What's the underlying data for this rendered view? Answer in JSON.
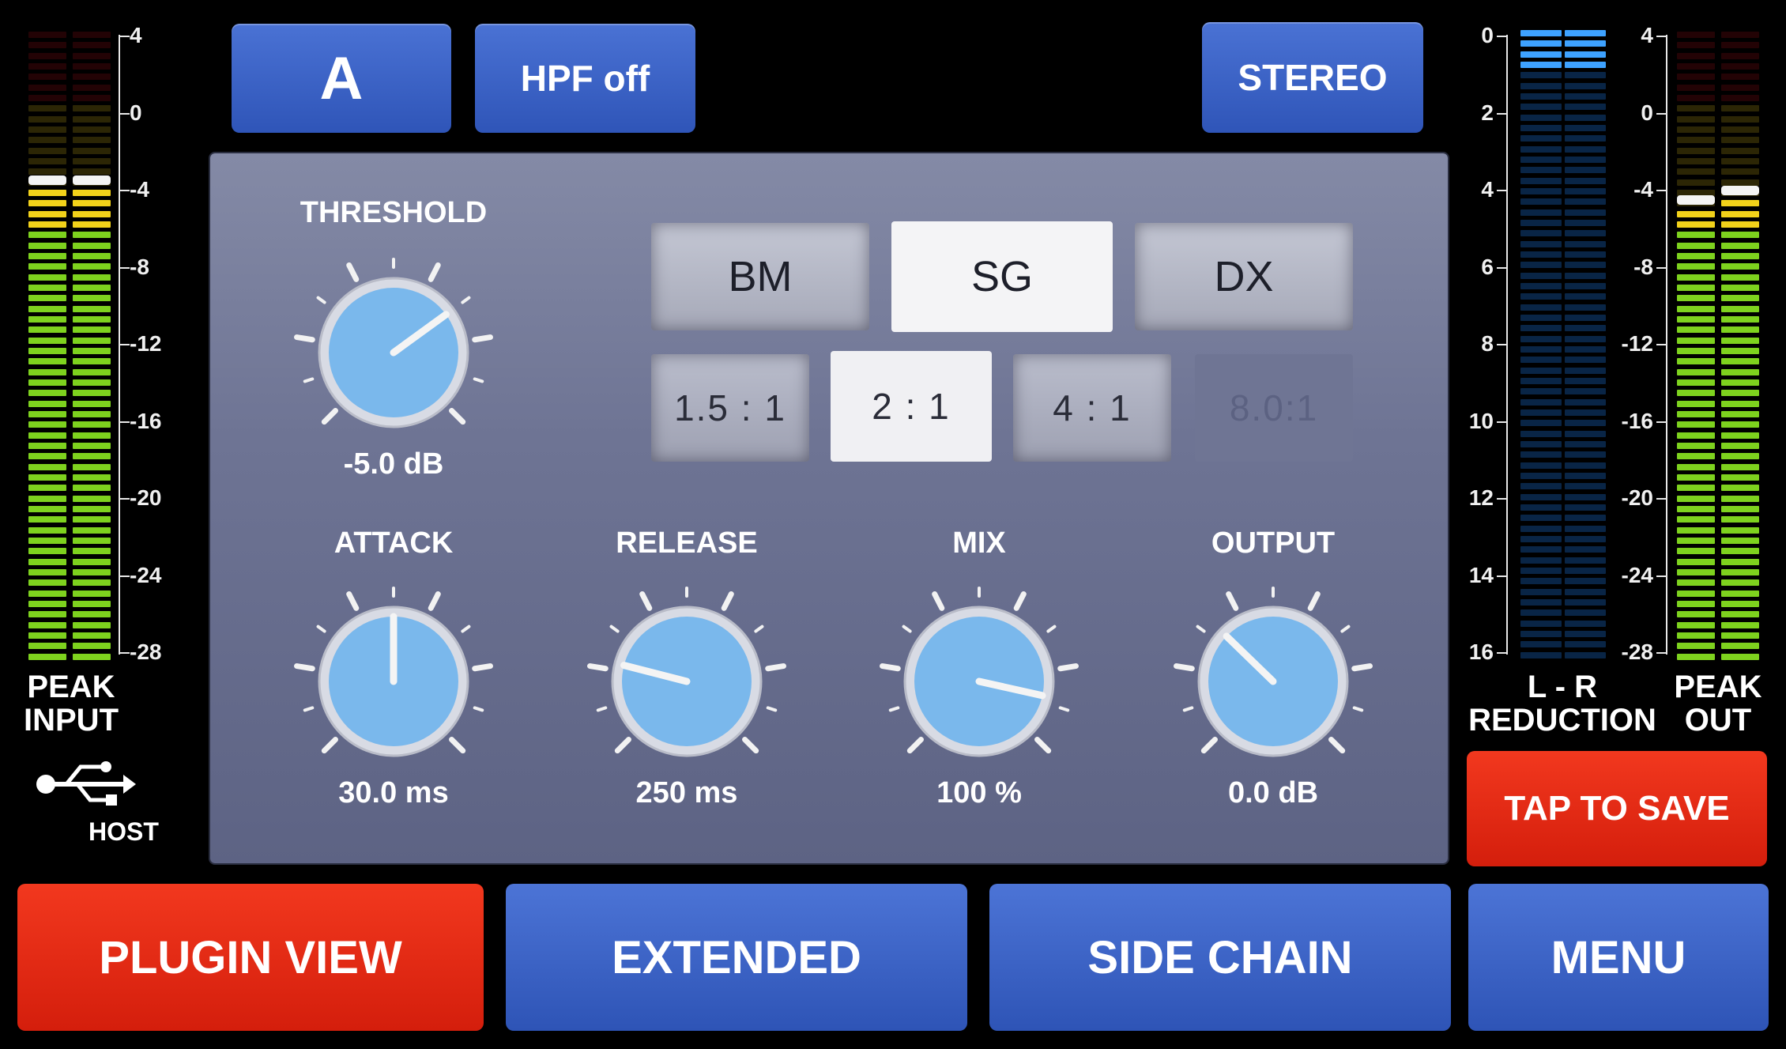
{
  "top": {
    "channel_label": "A",
    "hpf_label": "HPF off",
    "stereo_label": "STEREO"
  },
  "input_meter": {
    "title_line1": "PEAK",
    "title_line2": "INPUT",
    "scale": [
      "4",
      "0",
      "-4",
      "-8",
      "-12",
      "-16",
      "-20",
      "-24",
      "-28"
    ],
    "left_level_db": -4,
    "right_level_db": -4
  },
  "output_meter": {
    "title_line1": "PEAK",
    "title_line2": "OUT",
    "scale": [
      "4",
      "0",
      "-4",
      "-8",
      "-12",
      "-16",
      "-20",
      "-24",
      "-28"
    ],
    "left_level_db": -5,
    "right_level_db": -4.5
  },
  "reduction_meter": {
    "title_line1": "L - R",
    "title_line2": "REDUCTION",
    "scale": [
      "0",
      "2",
      "4",
      "6",
      "8",
      "10",
      "12",
      "14",
      "16"
    ],
    "left_reduction_db": 1,
    "right_reduction_db": 1
  },
  "usb": {
    "label": "HOST",
    "icon": "usb-icon"
  },
  "modes": [
    {
      "label": "BM",
      "selected": false
    },
    {
      "label": "SG",
      "selected": true
    },
    {
      "label": "DX",
      "selected": false
    }
  ],
  "ratios": [
    {
      "label": "1.5 : 1",
      "state": "normal"
    },
    {
      "label": "2 : 1",
      "state": "selected"
    },
    {
      "label": "4 : 1",
      "state": "normal"
    },
    {
      "label": "8.0:1",
      "state": "disabled"
    }
  ],
  "knobs": {
    "threshold": {
      "label": "THRESHOLD",
      "value": "-5.0 dB",
      "position": 0.7
    },
    "attack": {
      "label": "ATTACK",
      "value": "30.0 ms",
      "position": 0.5
    },
    "release": {
      "label": "RELEASE",
      "value": "250 ms",
      "position": 0.22
    },
    "mix": {
      "label": "MIX",
      "value": "100 %",
      "position": 0.88
    },
    "output": {
      "label": "OUTPUT",
      "value": "0.0 dB",
      "position": 0.33
    }
  },
  "save_label": "TAP TO SAVE",
  "bottom": {
    "plugin_view": "PLUGIN VIEW",
    "extended": "EXTENDED",
    "side_chain": "SIDE CHAIN",
    "menu": "MENU"
  },
  "colors": {
    "accent_blue": "#3a62c6",
    "accent_red": "#e22a14",
    "knob_blue": "#7ab8ec",
    "meter_green": "#7ed21e",
    "meter_yellow": "#f2d21a",
    "reduction_blue": "#1f7ae8"
  }
}
